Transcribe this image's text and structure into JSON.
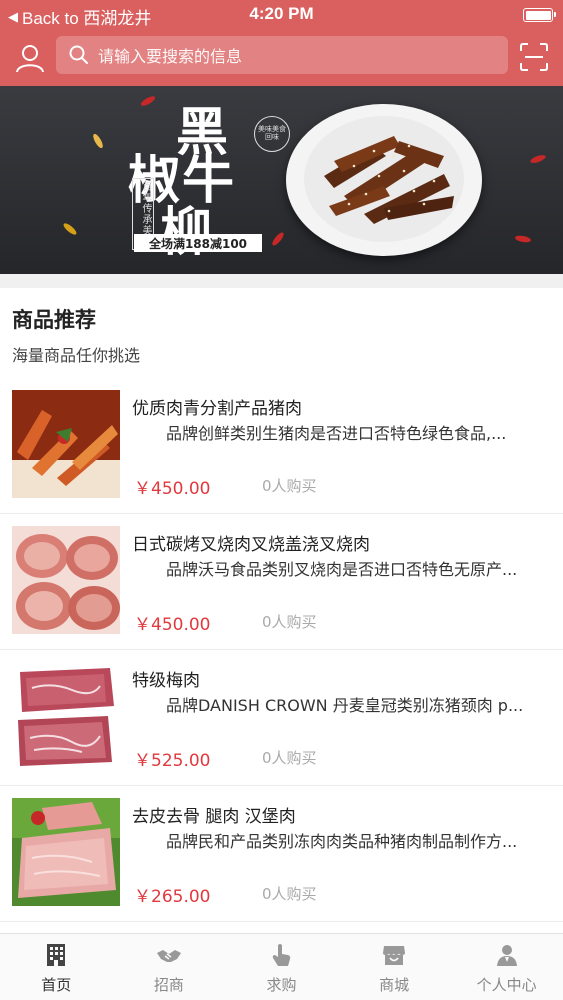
{
  "status_bar": {
    "back_label": "Back to 西湖龙井",
    "time": "4:20 PM"
  },
  "header": {
    "search_placeholder": "请输入要搜索的信息"
  },
  "banner": {
    "title_chars": [
      "黑",
      "椒牛",
      "柳"
    ],
    "vertical_text": "百年传承美食",
    "promo_text": "全场满188减100",
    "badge_text": "美味美食回味"
  },
  "section": {
    "title": "商品推荐",
    "subtitle": "海量商品任你挑选"
  },
  "products": [
    {
      "name": "优质肉青分割产品猪肉",
      "desc": "品牌创鲜类别生猪肉是否进口否特色绿色食品,...",
      "price": "￥450.00",
      "sold": "0人购买",
      "image": "sliced-cured-pork"
    },
    {
      "name": "日式碳烤叉烧肉叉烧盖浇叉烧肉",
      "desc": "品牌沃马食品类别叉烧肉是否进口否特色无原产...",
      "price": "￥450.00",
      "sold": "0人购买",
      "image": "char-siu-slices"
    },
    {
      "name": "特级梅肉",
      "desc": "品牌DANISH CROWN 丹麦皇冠类别冻猪颈肉 p...",
      "price": "￥525.00",
      "sold": "0人购买",
      "image": "pork-collar-blocks"
    },
    {
      "name": "去皮去骨 腿肉 汉堡肉",
      "desc": "品牌民和产品类别冻肉肉类品种猪肉制品制作方...",
      "price": "￥265.00",
      "sold": "0人购买",
      "image": "raw-leg-meat"
    }
  ],
  "tabbar": {
    "items": [
      {
        "label": "首页",
        "icon": "building-icon",
        "active": true
      },
      {
        "label": "招商",
        "icon": "handshake-icon",
        "active": false
      },
      {
        "label": "求购",
        "icon": "hand-pointer-icon",
        "active": false
      },
      {
        "label": "商城",
        "icon": "store-icon",
        "active": false
      },
      {
        "label": "个人中心",
        "icon": "person-icon",
        "active": false
      }
    ]
  },
  "colors": {
    "brand": "#da5f5f",
    "price": "#e0393e"
  }
}
